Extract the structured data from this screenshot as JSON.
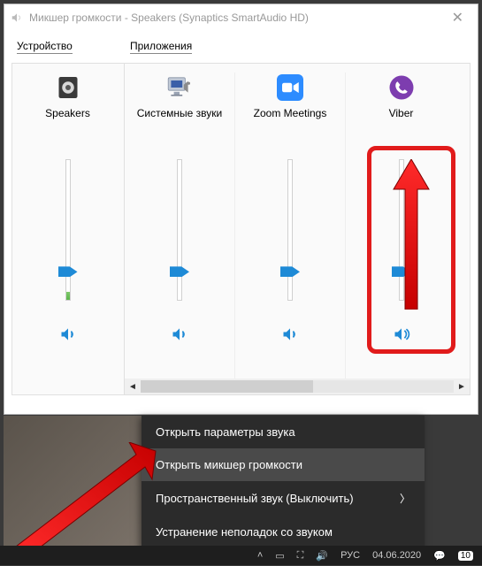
{
  "window": {
    "title": "Микшер громкости - Speakers (Synaptics SmartAudio HD)"
  },
  "sections": {
    "device_label": "Устройство",
    "apps_label": "Приложения"
  },
  "columns": [
    {
      "name": "Speakers",
      "level": 20,
      "peak": 6,
      "muted": false,
      "icon": "speaker-device"
    },
    {
      "name": "Системные звуки",
      "level": 20,
      "peak": 0,
      "muted": false,
      "icon": "system-sounds"
    },
    {
      "name": "Zoom Meetings",
      "level": 20,
      "peak": 0,
      "muted": false,
      "icon": "zoom"
    },
    {
      "name": "Viber",
      "level": 20,
      "peak": 0,
      "muted": false,
      "icon": "viber"
    }
  ],
  "context_menu": {
    "items": [
      {
        "label": "Открыть параметры звука",
        "has_submenu": false,
        "selected": false
      },
      {
        "label": "Открыть микшер громкости",
        "has_submenu": false,
        "selected": true
      },
      {
        "label": "Пространственный звук (Выключить)",
        "has_submenu": true,
        "selected": false
      },
      {
        "label": "Устранение неполадок со звуком",
        "has_submenu": false,
        "selected": false
      }
    ]
  },
  "taskbar": {
    "date": "04.06.2020",
    "notification_count": "10"
  }
}
